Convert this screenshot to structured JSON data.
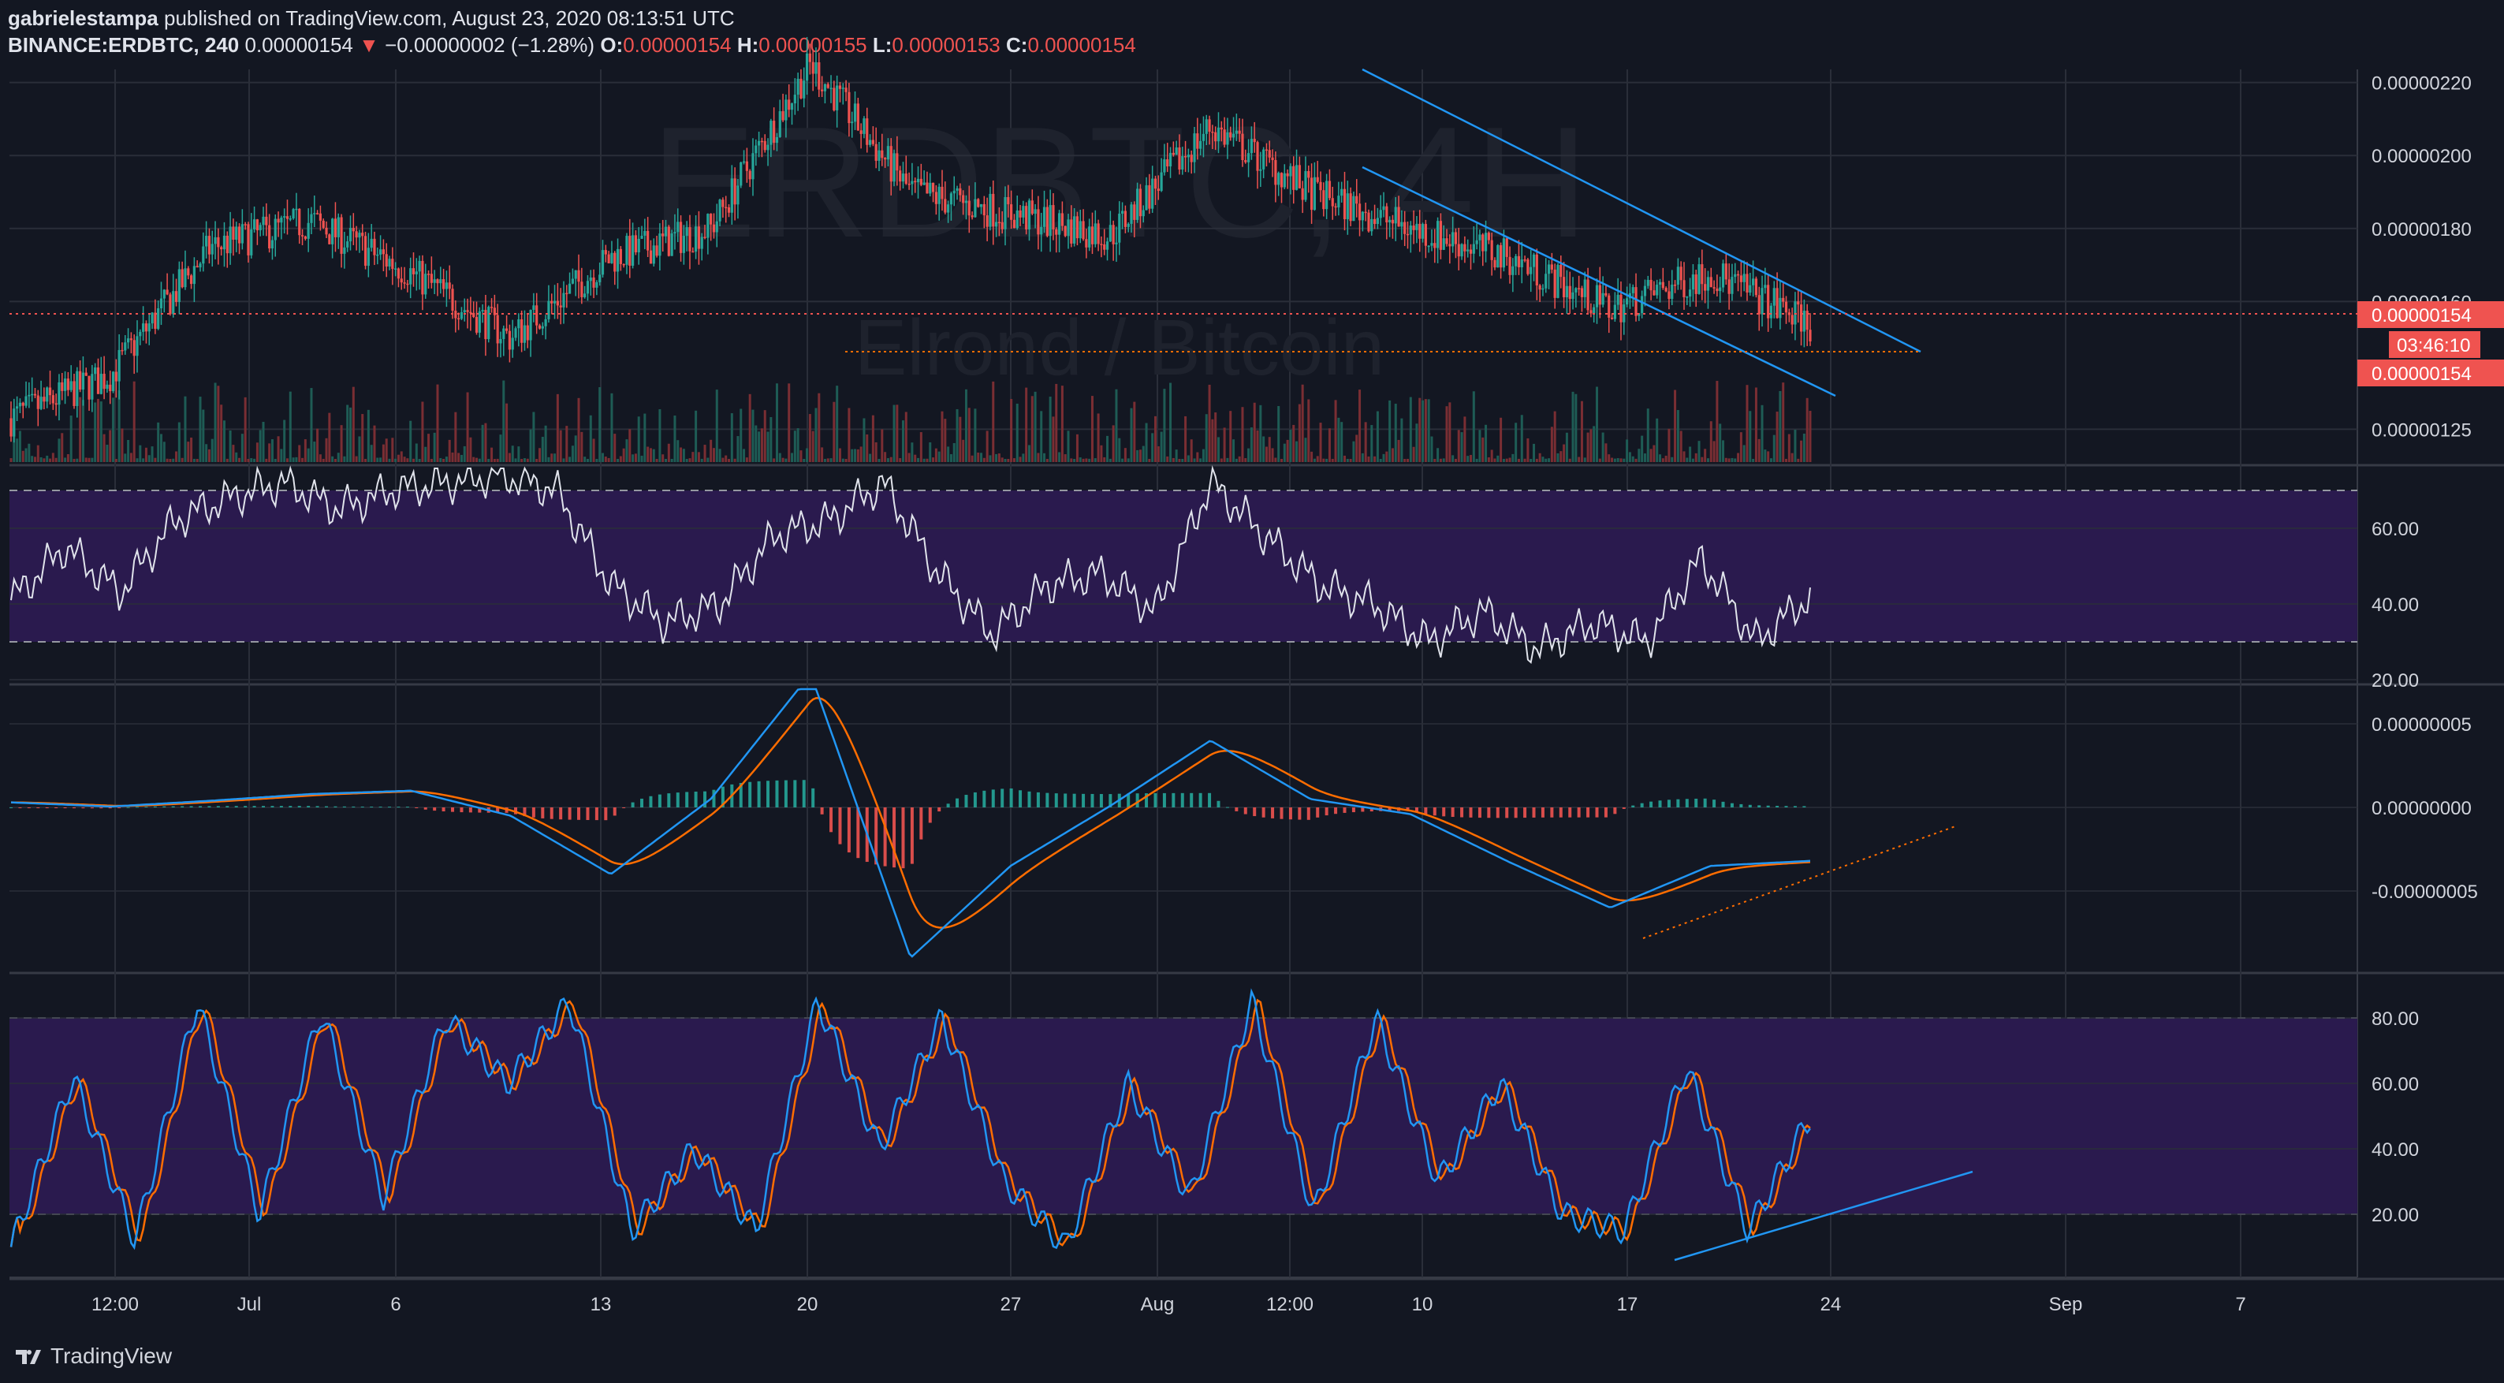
{
  "header": {
    "publisher_user": "gabrielestampa",
    "publisher_suffix": "published on TradingView.com, August 23, 2020 08:13:51 UTC",
    "symbol": "BINANCE:ERDBTC, 240",
    "last": "0.00000154",
    "change_arrow": "▼",
    "change": "−0.00000002 (−1.28%)",
    "o_label": "O:",
    "o": "0.00000154",
    "h_label": "H:",
    "h": "0.00000155",
    "l_label": "L:",
    "l": "0.00000153",
    "c_label": "C:",
    "c": "0.00000154"
  },
  "watermark": {
    "symbol": "ERDBTC, 4H",
    "description": "Elrond / Bitcoin"
  },
  "footer": {
    "brand": "TradingView"
  },
  "colors": {
    "background": "#131722",
    "up": "#26a69a",
    "down": "#ef5350",
    "blue": "#2196f3",
    "orange": "#ff6d00",
    "band": "#2a1a4e",
    "grid": "#2a2e39"
  },
  "chart_data": [
    {
      "type": "candlestick",
      "title": "BINANCE:ERDBTC, 240",
      "x_ticks": [
        "12:00",
        "Jul",
        "6",
        "13",
        "20",
        "27",
        "Aug",
        "12:00",
        "10",
        "17",
        "24",
        "Sep",
        "7"
      ],
      "y_ticks": [
        "0.00000125",
        "0.00000160",
        "0.00000180",
        "0.00000200",
        "0.00000220"
      ],
      "ylim": [
        1.16e-06,
        2.21e-06
      ],
      "last_price_label": "0.00000154",
      "countdown_label": "03:46:10",
      "bid_label": "0.00000154",
      "approx_closes": [
        1.28e-06,
        1.4e-06,
        1.75e-06,
        1.82e-06,
        1.68e-06,
        1.5e-06,
        1.72e-06,
        1.8e-06,
        2.25e-06,
        1.9e-06,
        1.84e-06,
        1.78e-06,
        2.08e-06,
        1.9e-06,
        1.8e-06,
        1.72e-06,
        1.58e-06,
        1.68e-06,
        1.54e-06
      ],
      "annotations": [
        "descending channel (two parallel blue lines)",
        "orange dotted support at ~0.00000147",
        "orange dotted price line at 0.00000154"
      ]
    },
    {
      "type": "line",
      "title": "RSI",
      "y_ticks": [
        "20.00",
        "40.00",
        "60.00"
      ],
      "bands": [
        30,
        70
      ],
      "approx_values": [
        41,
        55,
        43,
        62,
        68,
        72,
        65,
        70,
        72,
        74,
        70,
        45,
        35,
        40,
        58,
        62,
        72,
        48,
        32,
        45,
        48,
        38,
        72,
        58,
        45,
        40,
        30,
        38,
        28,
        35,
        30,
        52,
        30,
        42
      ]
    },
    {
      "type": "line",
      "title": "MACD",
      "y_ticks": [
        "0.00000005",
        "0.00000000",
        "-0.00000005"
      ],
      "series_count": 2,
      "approx_macd": [
        3e-09,
        5e-10,
        4e-09,
        8e-09,
        1e-08,
        -5e-09,
        -4e-08,
        5e-09,
        8e-08,
        -9e-08,
        -3.5e-08,
        1e-09,
        4e-08,
        5e-09,
        -4e-09,
        -3.3e-08,
        -6e-08,
        -3.5e-08,
        -3.2e-08
      ],
      "annotations": [
        "orange dotted rising line under MACD lows"
      ]
    },
    {
      "type": "line",
      "title": "Stoch RSI",
      "y_ticks": [
        "20.00",
        "40.00",
        "60.00",
        "80.00"
      ],
      "bands": [
        20,
        80
      ],
      "approx_k": [
        10,
        62,
        12,
        85,
        20,
        82,
        25,
        80,
        60,
        85,
        15,
        40,
        15,
        85,
        40,
        80,
        30,
        10,
        60,
        25,
        85,
        20,
        80,
        30,
        60,
        20,
        15,
        65,
        15,
        50
      ],
      "annotations": [
        "blue rising trendline under Stoch RSI lows"
      ]
    }
  ]
}
